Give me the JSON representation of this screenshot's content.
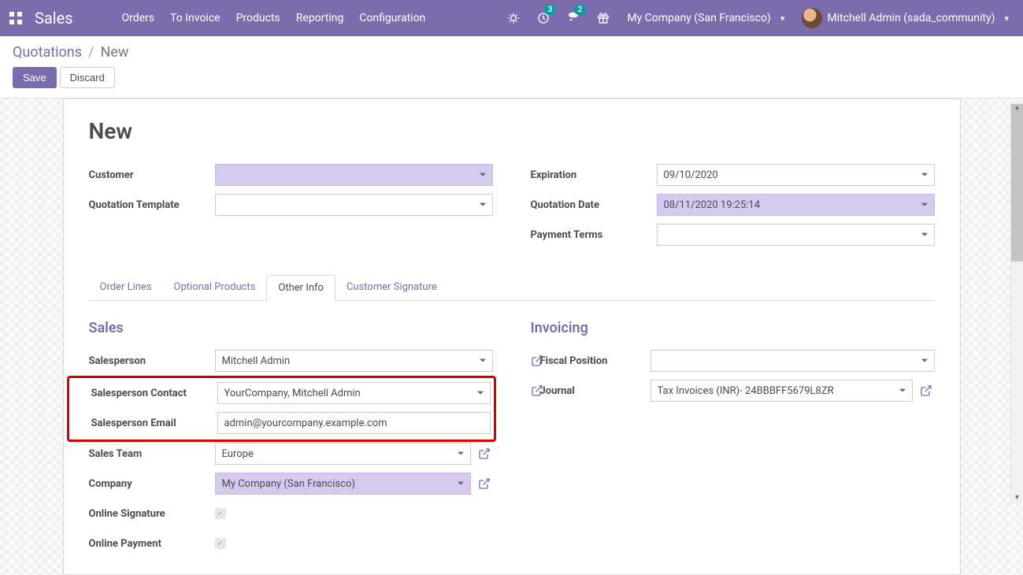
{
  "navbar": {
    "brand": "Sales",
    "menu": [
      "Orders",
      "To Invoice",
      "Products",
      "Reporting",
      "Configuration"
    ],
    "activities_badge": "3",
    "messages_badge": "2",
    "company": "My Company (San Francisco)",
    "user": "Mitchell Admin (sada_community)"
  },
  "breadcrumb": {
    "parent": "Quotations",
    "current": "New"
  },
  "buttons": {
    "save": "Save",
    "discard": "Discard"
  },
  "form": {
    "title": "New",
    "left": {
      "customer_label": "Customer",
      "customer_value": "",
      "quotation_template_label": "Quotation Template",
      "quotation_template_value": ""
    },
    "right": {
      "expiration_label": "Expiration",
      "expiration_value": "09/10/2020",
      "quotation_date_label": "Quotation Date",
      "quotation_date_value": "08/11/2020 19:25:14",
      "payment_terms_label": "Payment Terms",
      "payment_terms_value": ""
    }
  },
  "tabs": [
    "Order Lines",
    "Optional Products",
    "Other Info",
    "Customer Signature"
  ],
  "active_tab_index": 2,
  "sales_section": {
    "title": "Sales",
    "salesperson_label": "Salesperson",
    "salesperson_value": "Mitchell Admin",
    "salesperson_contact_label": "Salesperson Contact",
    "salesperson_contact_value": "YourCompany, Mitchell Admin",
    "salesperson_email_label": "Salesperson Email",
    "salesperson_email_value": "admin@yourcompany.example.com",
    "sales_team_label": "Sales Team",
    "sales_team_value": "Europe",
    "company_label": "Company",
    "company_value": "My Company (San Francisco)",
    "online_signature_label": "Online Signature",
    "online_payment_label": "Online Payment"
  },
  "invoicing_section": {
    "title": "Invoicing",
    "fiscal_position_label": "Fiscal Position",
    "fiscal_position_value": "",
    "journal_label": "Journal",
    "journal_value": "Tax Invoices (INR)- 24BBBFF5679L8ZR"
  }
}
